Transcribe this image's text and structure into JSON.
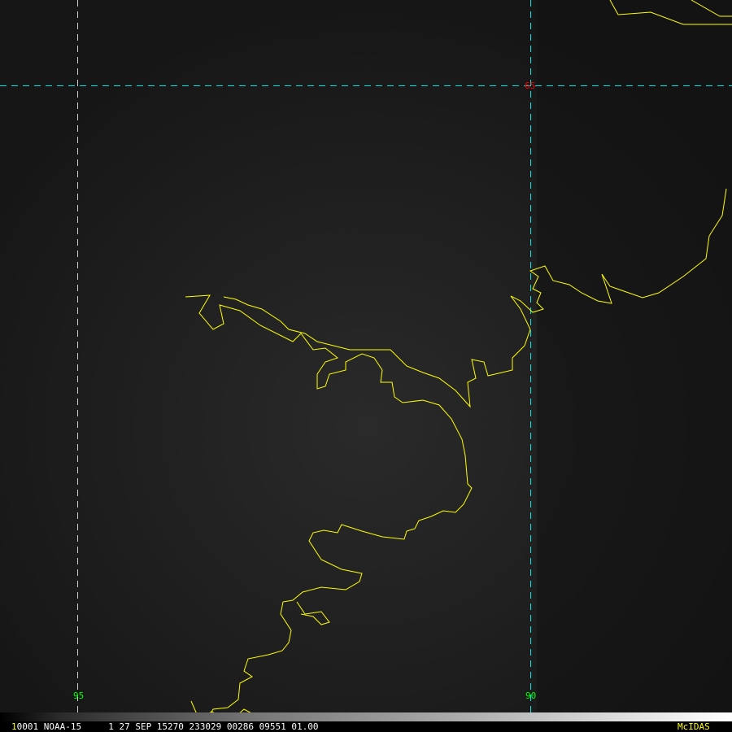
{
  "grid_labels": {
    "lat_65": "65",
    "lon_95": "95",
    "lon_90": "90"
  },
  "footer": {
    "frame_number": "1",
    "info_text": "0001 NOAA-15     1 27 SEP 15270 233029 00286 09551 01.00",
    "brand": "McIDAS"
  },
  "colors": {
    "coast": "#ffff00",
    "grid": "#00e5e5",
    "lat_label": "#ff0000",
    "lon_label": "#00ff00",
    "brand": "#ffff00"
  }
}
